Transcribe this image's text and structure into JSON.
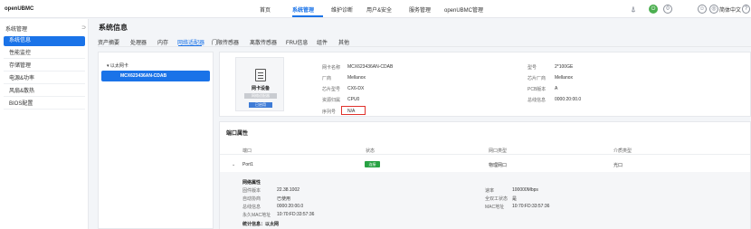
{
  "app": {
    "logo": "openUBMC"
  },
  "topnav": {
    "items": [
      {
        "label": "首页",
        "active": false
      },
      {
        "label": "系统管理",
        "active": true
      },
      {
        "label": "维护诊断",
        "active": false
      },
      {
        "label": "用户&安全",
        "active": false
      },
      {
        "label": "服务管理",
        "active": false
      },
      {
        "label": "openUBMC管理",
        "active": false
      }
    ],
    "alert_count": "0",
    "language": "简体中文"
  },
  "sidebar": {
    "header": "系统管理",
    "items": [
      {
        "label": "系统信息",
        "active": true
      },
      {
        "label": "性能监控",
        "active": false
      },
      {
        "label": "存储管理",
        "active": false
      },
      {
        "label": "电源&功率",
        "active": false
      },
      {
        "label": "风扇&散热",
        "active": false
      },
      {
        "label": "BIOS配置",
        "active": false
      }
    ]
  },
  "page": {
    "title": "系统信息",
    "tabs": [
      {
        "label": "资产摘要",
        "active": false
      },
      {
        "label": "处理器",
        "active": false
      },
      {
        "label": "内存",
        "active": false
      },
      {
        "label": "网络适配器",
        "active": true
      },
      {
        "label": "门限传感器",
        "active": false
      },
      {
        "label": "离散传感器",
        "active": false
      },
      {
        "label": "FRU信息",
        "active": false
      },
      {
        "label": "组件",
        "active": false
      },
      {
        "label": "其他",
        "active": false
      }
    ]
  },
  "tree": {
    "root": "以太网卡",
    "node": "MCX623436AN-CDAB"
  },
  "device_card": {
    "title": "网卡设备",
    "button_grey": "网络适配器",
    "button_blue": "已启用",
    "left_fields": [
      {
        "label": "网卡名称",
        "value": "MCX623436AN-CDAB"
      },
      {
        "label": "厂商",
        "value": "Mellanox"
      },
      {
        "label": "芯片型号",
        "value": "CX6-DX"
      },
      {
        "label": "资源归属",
        "value": "CPU0"
      },
      {
        "label": "序列号",
        "value": "N/A"
      }
    ],
    "right_fields": [
      {
        "label": "型号",
        "value": "2*100GE"
      },
      {
        "label": "芯片厂商",
        "value": "Mellanox"
      },
      {
        "label": "PCB版本",
        "value": "A"
      },
      {
        "label": "总线信息",
        "value": "0000:20:00.0"
      }
    ]
  },
  "ports": {
    "title": "端口属性",
    "columns": [
      "端口",
      "状态",
      "网口类型",
      "介质类型"
    ],
    "rows": [
      {
        "port": "Port1",
        "status": "连接",
        "type": "物理网口",
        "media": "光口"
      }
    ],
    "details": {
      "section_title": "网络属性",
      "left": [
        {
          "label": "固件版本",
          "value": "22.38.1002"
        },
        {
          "label": "自动协商",
          "value": "已使用"
        },
        {
          "label": "总线信息",
          "value": "0000:20:00.0"
        },
        {
          "label": "永久MAC地址",
          "value": "10:70:FD:33:57:36"
        }
      ],
      "right": [
        {
          "label": "速率",
          "value": "100000Mbps"
        },
        {
          "label": "全双工状态",
          "value": "是"
        },
        {
          "label": "MAC地址",
          "value": "10:70:FD:33:57:36"
        }
      ],
      "stats_title": "统计信息：以太网"
    }
  }
}
